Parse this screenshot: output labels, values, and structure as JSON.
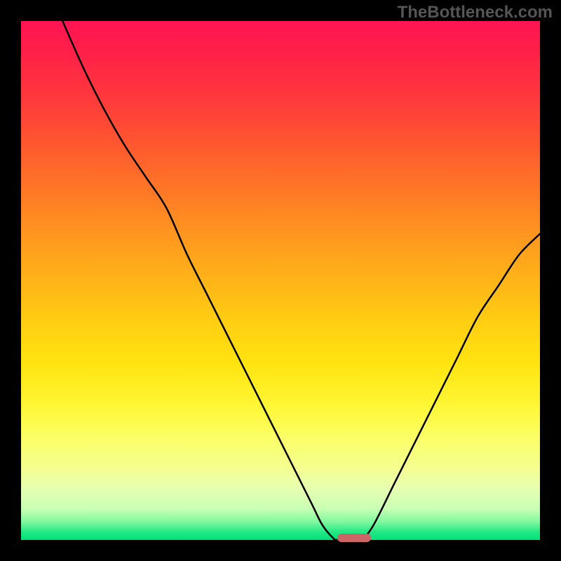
{
  "credit_text": "TheBottleneck.com",
  "colors": {
    "frame": "#000000",
    "gradient_stops": [
      {
        "offset": 0.0,
        "color": "#ff1452"
      },
      {
        "offset": 0.05,
        "color": "#ff1e4a"
      },
      {
        "offset": 0.12,
        "color": "#ff3040"
      },
      {
        "offset": 0.2,
        "color": "#ff4a34"
      },
      {
        "offset": 0.3,
        "color": "#ff6e28"
      },
      {
        "offset": 0.4,
        "color": "#ff9220"
      },
      {
        "offset": 0.5,
        "color": "#ffb418"
      },
      {
        "offset": 0.58,
        "color": "#ffce12"
      },
      {
        "offset": 0.66,
        "color": "#ffe410"
      },
      {
        "offset": 0.74,
        "color": "#fff634"
      },
      {
        "offset": 0.8,
        "color": "#fcff64"
      },
      {
        "offset": 0.86,
        "color": "#f4ff90"
      },
      {
        "offset": 0.9,
        "color": "#e8ffb0"
      },
      {
        "offset": 0.94,
        "color": "#c8ffb4"
      },
      {
        "offset": 0.965,
        "color": "#80f8a0"
      },
      {
        "offset": 0.985,
        "color": "#20e884"
      },
      {
        "offset": 1.0,
        "color": "#00e07a"
      }
    ],
    "curve_stroke": "#000000",
    "marker_fill": "#cc6666",
    "credit_color": "#555555"
  },
  "chart_data": {
    "type": "line",
    "title": "",
    "xlabel": "",
    "ylabel": "",
    "xlim": [
      0,
      100
    ],
    "ylim": [
      0,
      100
    ],
    "grid": false,
    "series": [
      {
        "name": "bottleneck-curve",
        "points": [
          {
            "x": 8,
            "y": 100
          },
          {
            "x": 12,
            "y": 91
          },
          {
            "x": 16,
            "y": 83
          },
          {
            "x": 20,
            "y": 76
          },
          {
            "x": 24,
            "y": 70
          },
          {
            "x": 28,
            "y": 64
          },
          {
            "x": 32,
            "y": 55
          },
          {
            "x": 36,
            "y": 47
          },
          {
            "x": 40,
            "y": 39
          },
          {
            "x": 44,
            "y": 31
          },
          {
            "x": 48,
            "y": 23
          },
          {
            "x": 52,
            "y": 15
          },
          {
            "x": 56,
            "y": 7
          },
          {
            "x": 58,
            "y": 3
          },
          {
            "x": 60,
            "y": 0.5
          },
          {
            "x": 61,
            "y": 0
          },
          {
            "x": 64,
            "y": 0
          },
          {
            "x": 66,
            "y": 0.5
          },
          {
            "x": 68,
            "y": 3
          },
          {
            "x": 72,
            "y": 11
          },
          {
            "x": 76,
            "y": 19
          },
          {
            "x": 80,
            "y": 27
          },
          {
            "x": 84,
            "y": 35
          },
          {
            "x": 88,
            "y": 43
          },
          {
            "x": 92,
            "y": 49
          },
          {
            "x": 96,
            "y": 55
          },
          {
            "x": 100,
            "y": 59
          }
        ]
      }
    ],
    "marker": {
      "x_start": 61,
      "x_end": 67.5,
      "y": 0
    }
  }
}
